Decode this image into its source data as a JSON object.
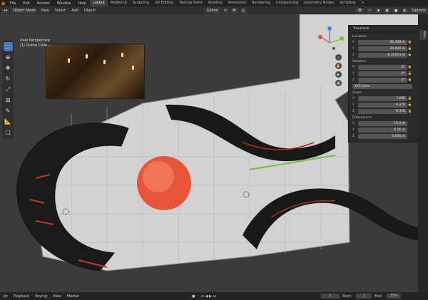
{
  "topbar": {
    "menus": [
      "File",
      "Edit",
      "Render",
      "Window",
      "Help"
    ],
    "workspaces": [
      "Layout",
      "Modeling",
      "Sculpting",
      "UV Editing",
      "Texture Paint",
      "Shading",
      "Animation",
      "Rendering",
      "Compositing",
      "Geometry Nodes",
      "Scripting"
    ],
    "active_workspace": "Layout",
    "add_tab": "+"
  },
  "header": {
    "mode": "Object Mode",
    "menus": [
      "View",
      "Select",
      "Add",
      "Object"
    ],
    "transform_orientation": "Global",
    "options": "Options"
  },
  "overlay": {
    "line1": "User Perspective",
    "line2": "(1) Scene Colle..."
  },
  "transform_panel": {
    "title": "Transform",
    "location_label": "Location:",
    "location": {
      "x": "26.448 m",
      "y": "29.816 m",
      "z": "-0.32013 m"
    },
    "rotation_label": "Rotation:",
    "rotation": {
      "x": "0°",
      "y": "0°",
      "z": "0°"
    },
    "rotation_mode": "XYZ Euler",
    "scale_label": "Scale:",
    "scale": {
      "x": "7.696",
      "y": "-4.279",
      "z": "-0.328"
    },
    "dimensions_label": "Dimensions:",
    "dimensions": {
      "x": "15.4 m",
      "y": "8.56 m",
      "z": "0.656 m"
    }
  },
  "timeline": {
    "playback": "Playback",
    "keying": "Keying",
    "view": "View",
    "marker": "Marker",
    "current_frame": "1",
    "start_label": "Start",
    "start": "1",
    "end_label": "End",
    "end": "250"
  },
  "colors": {
    "accent": "#4772b3",
    "orange": "#e87d0d",
    "gizmo_x": "#e04d4d",
    "gizmo_y": "#7cbf2e",
    "gizmo_z": "#4b7bd6"
  }
}
